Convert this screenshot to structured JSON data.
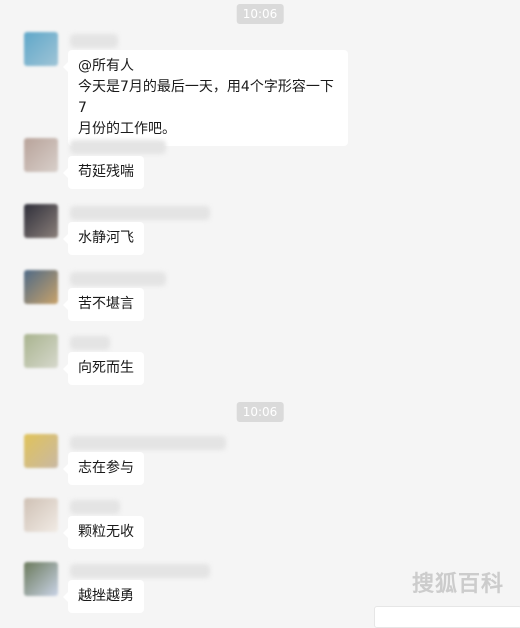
{
  "time_labels": [
    "10:06",
    "10:06"
  ],
  "messages": [
    {
      "lines": [
        "@所有人",
        "今天是7月的最后一天，用4个字形容一下7",
        "月份的工作吧。"
      ],
      "avatar_colors": [
        "#5fa7c9",
        "#9fc4d6"
      ]
    },
    {
      "lines": [
        "苟延残喘"
      ],
      "avatar_colors": [
        "#b8a39a",
        "#d8cfca"
      ]
    },
    {
      "lines": [
        "水静河飞"
      ],
      "avatar_colors": [
        "#2f2f3a",
        "#8a7f7a"
      ]
    },
    {
      "lines": [
        "苦不堪言"
      ],
      "avatar_colors": [
        "#4f6a86",
        "#c8a26a"
      ]
    },
    {
      "lines": [
        "向死而生"
      ],
      "avatar_colors": [
        "#a9b48f",
        "#d6d8cc"
      ]
    },
    {
      "lines": [
        "志在参与"
      ],
      "avatar_colors": [
        "#e0c35a",
        "#c9b8a3"
      ]
    },
    {
      "lines": [
        "颗粒无收"
      ],
      "avatar_colors": [
        "#cfc1b5",
        "#f1ebe5"
      ]
    },
    {
      "lines": [
        "越挫越勇"
      ],
      "avatar_colors": [
        "#6b7a5c",
        "#c9d3e6"
      ]
    }
  ],
  "watermark": "搜狐百科"
}
